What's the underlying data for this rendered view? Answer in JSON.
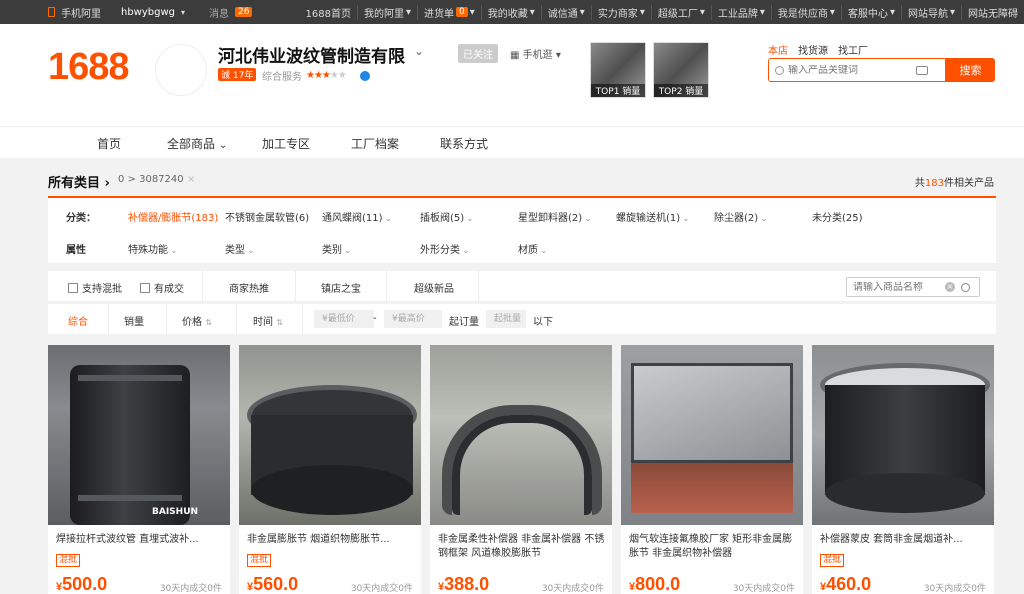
{
  "topbar": {
    "mobile_label": "手机阿里",
    "username": "hbwybgwg",
    "messages_label": "消息",
    "messages_count": "26",
    "links": [
      "1688首页",
      "我的阿里",
      "进货单",
      "我的收藏",
      "诚信通",
      "实力商家",
      "超级工厂",
      "工业品牌",
      "我是供应商",
      "客服中心",
      "网站导航",
      "网站无障碍"
    ],
    "cart_count": "0"
  },
  "header": {
    "logo": "1688",
    "company_name": "河北伟业波纹管制造有限",
    "years_badge": "诚 17年",
    "service_label": "综合服务",
    "followed_label": "已关注",
    "mobile_shop_label": "手机逛",
    "top1_label": "TOP1 销量",
    "top2_label": "TOP2 销量",
    "search_tabs": [
      "本店",
      "找货源",
      "找工厂"
    ],
    "search_placeholder": "输入产品关键词",
    "search_button": "搜索",
    "rating_stars": 3
  },
  "nav": {
    "items": [
      "首页",
      "全部商品",
      "加工专区",
      "工厂档案",
      "联系方式"
    ]
  },
  "category": {
    "title": "所有类目",
    "path": "0 > 3087240",
    "total_prefix": "共",
    "total_count": "183",
    "total_suffix": "件相关产品"
  },
  "filters": {
    "category_label": "分类：",
    "categories": [
      "补偿器/膨胀节(183)",
      "不锈钢金属软管(6)",
      "通风蝶阀(11)",
      "插板阀(5)",
      "星型卸料器(2)",
      "螺旋输送机(1)",
      "除尘器(2)",
      "未分类(25)"
    ],
    "attr_label": "属性",
    "attributes": [
      "特殊功能",
      "类型",
      "类别",
      "外形分类",
      "材质"
    ]
  },
  "toolbar": {
    "mixed_batch": "支持混批",
    "has_deals": "有成交",
    "merchant_recommend": "商家热推",
    "shop_treasure": "镇店之宝",
    "super_new": "超级新品",
    "product_search_placeholder": "请输入商品名称"
  },
  "sortbar": {
    "comprehensive": "综合",
    "sales": "销量",
    "price": "价格",
    "time": "时间",
    "min_price_placeholder": "¥最低价",
    "dash": "-",
    "max_price_placeholder": "¥最高价",
    "moq_label": "起订量",
    "moq_placeholder": "起批量",
    "below": "以下"
  },
  "products": [
    {
      "title": "焊接拉杆式波纹管 直埋式波补...",
      "tag": "混批",
      "price": "500.0",
      "deal": "30天内成交0件",
      "watermark": "BAISHUN"
    },
    {
      "title": "非金属膨胀节 烟道织物膨胀节...",
      "tag": "混批",
      "price": "560.0",
      "deal": "30天内成交0件"
    },
    {
      "title": "非金属柔性补偿器 非金属补偿器 不锈钢框架 风道橡胶膨胀节",
      "tag": "",
      "price": "388.0",
      "deal": "30天内成交0件"
    },
    {
      "title": "烟气软连接氟橡胶厂家 矩形非金属膨胀节 非金属织物补偿器",
      "tag": "",
      "price": "800.0",
      "deal": "30天内成交0件"
    },
    {
      "title": "补偿器蒙皮 套筒非金属烟道补...",
      "tag": "混批",
      "price": "460.0",
      "deal": "30天内成交0件"
    }
  ],
  "currency": "¥",
  "colors": {
    "accent": "#ff5000",
    "topbar": "#3c3c3c"
  }
}
